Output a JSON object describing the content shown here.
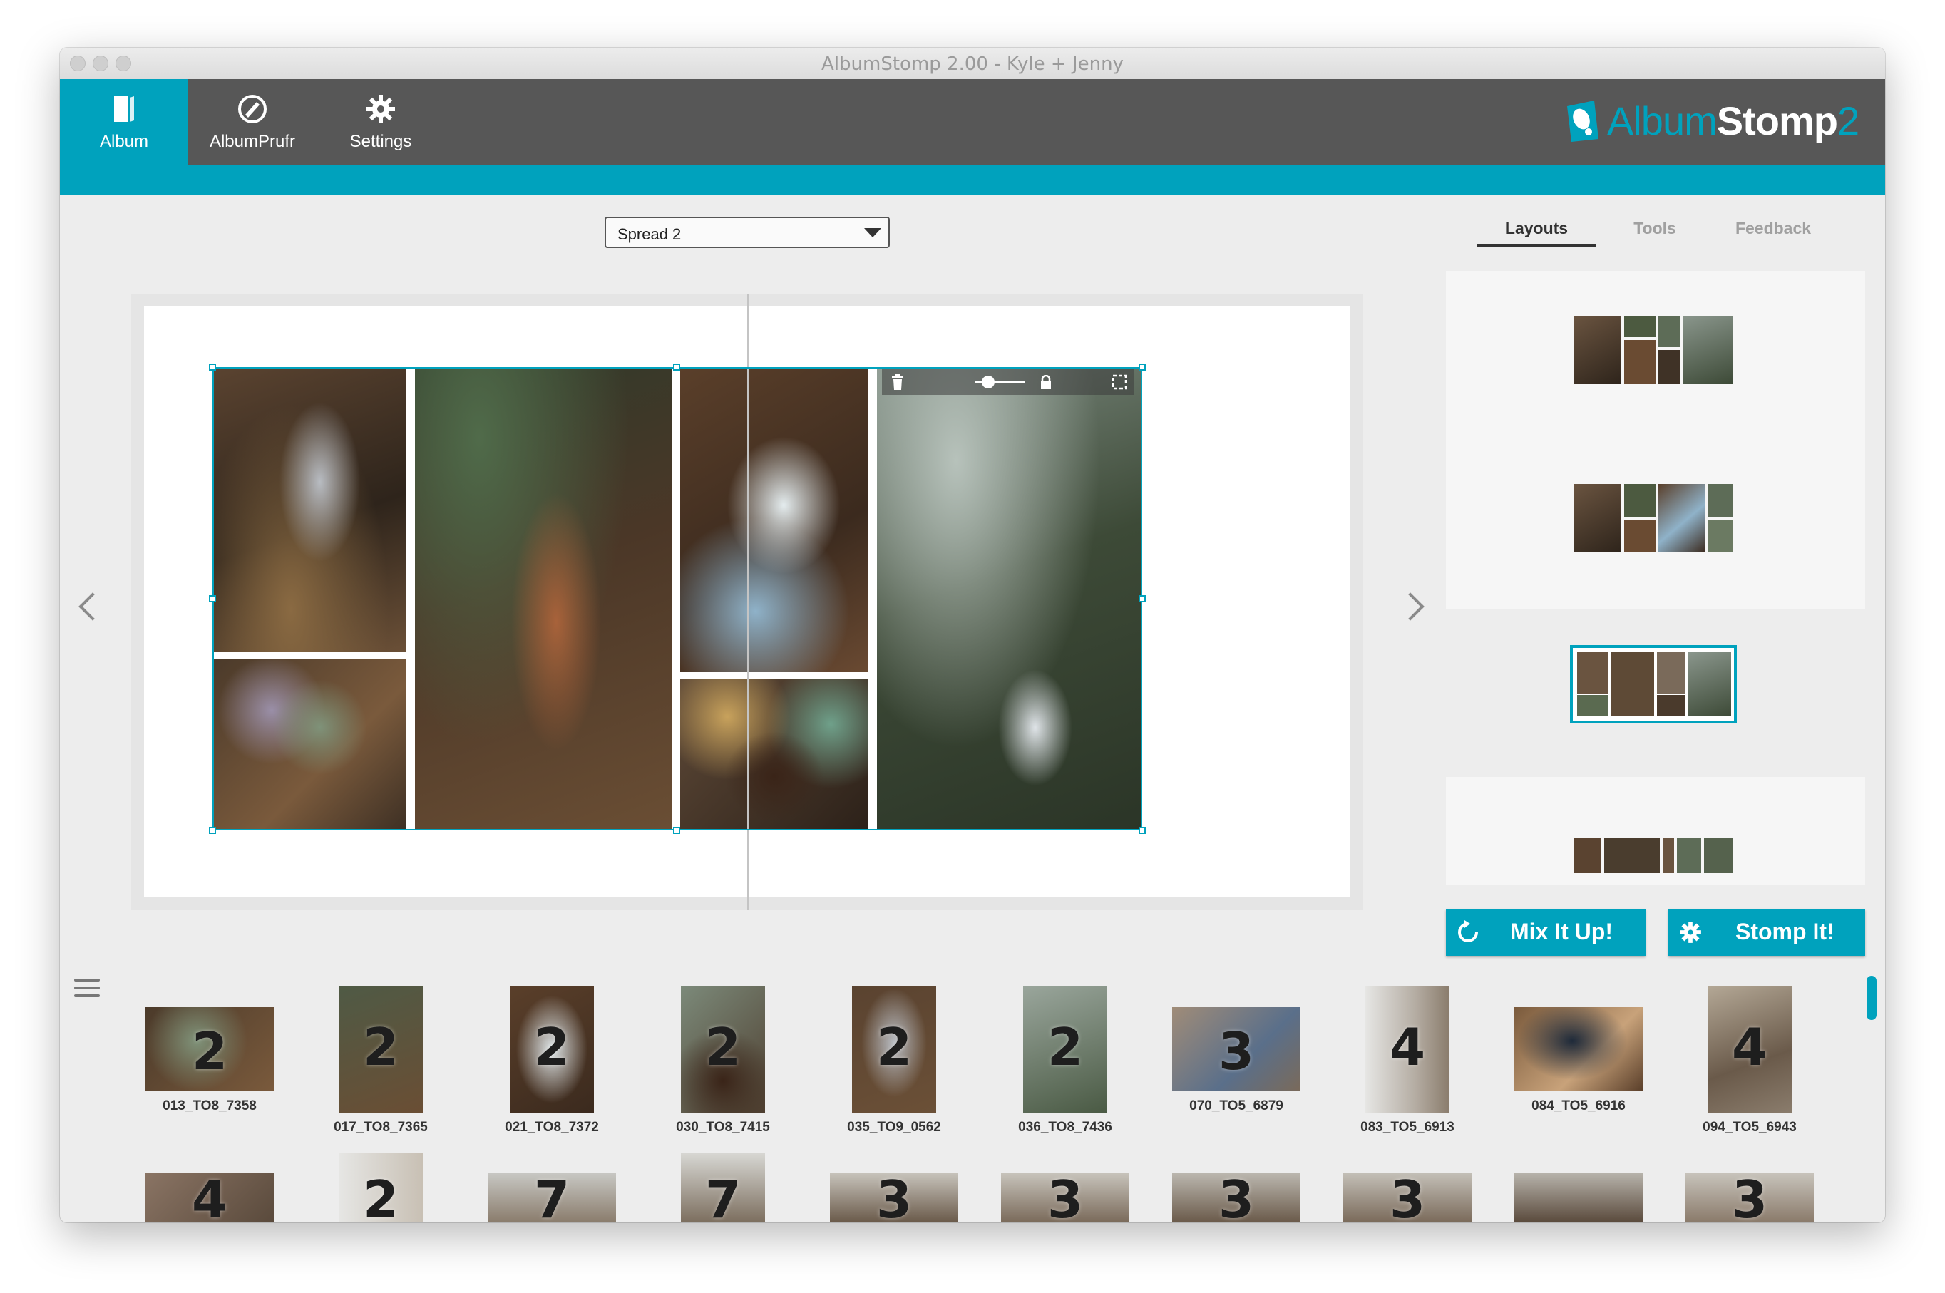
{
  "window": {
    "title": "AlbumStomp 2.00 - Kyle + Jenny"
  },
  "nav": {
    "items": [
      {
        "label": "Album",
        "icon": "album-icon",
        "active": true
      },
      {
        "label": "AlbumPrufr",
        "icon": "prufr-icon",
        "active": false
      },
      {
        "label": "Settings",
        "icon": "gear-icon",
        "active": false
      }
    ]
  },
  "brand": {
    "text_light": "Album",
    "text_bold": "Stomp",
    "text_num": "2"
  },
  "spread": {
    "selected": "Spread 2"
  },
  "right_tabs": [
    {
      "label": "Layouts",
      "active": true
    },
    {
      "label": "Tools",
      "active": false
    },
    {
      "label": "Feedback",
      "active": false
    }
  ],
  "actions": {
    "mix": "Mix It Up!",
    "stomp": "Stomp It!"
  },
  "filmstrip": [
    {
      "count": "2",
      "name": "013_TO8_7358"
    },
    {
      "count": "2",
      "name": "017_TO8_7365"
    },
    {
      "count": "2",
      "name": "021_TO8_7372"
    },
    {
      "count": "2",
      "name": "030_TO8_7415"
    },
    {
      "count": "2",
      "name": "035_TO9_0562"
    },
    {
      "count": "2",
      "name": "036_TO8_7436"
    },
    {
      "count": "3",
      "name": "070_TO5_6879"
    },
    {
      "count": "4",
      "name": "083_TO5_6913"
    },
    {
      "count": "",
      "name": "084_TO5_6916"
    },
    {
      "count": "4",
      "name": "094_TO5_6943"
    }
  ],
  "filmstrip_row2_counts": [
    "4",
    "2",
    "7",
    "7",
    "3",
    "3",
    "3",
    "3",
    "",
    "3"
  ],
  "colors": {
    "accent": "#00a2bd",
    "appbar": "#575757",
    "background": "#ededed"
  }
}
